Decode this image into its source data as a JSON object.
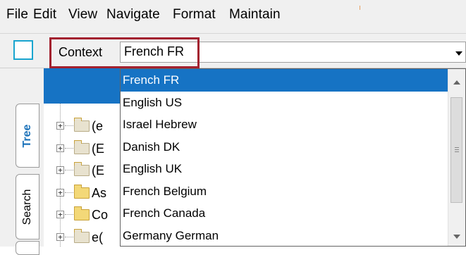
{
  "menu": {
    "items": [
      "File",
      "Edit",
      "View",
      "Navigate",
      "Format",
      "Maintain"
    ]
  },
  "toolbar": {
    "context_label": "Context",
    "context_value": "French FR"
  },
  "sidebar": {
    "tabs": [
      "Tree",
      "Search"
    ]
  },
  "tree": {
    "rows": [
      {
        "text": "(e",
        "folder": "gray"
      },
      {
        "text": "(E",
        "folder": "gray"
      },
      {
        "text": "(E",
        "folder": "gray"
      },
      {
        "text": "As",
        "folder": "yellow"
      },
      {
        "text": "Co",
        "folder": "yellow"
      },
      {
        "text": "e(",
        "folder": "gray"
      }
    ]
  },
  "dropdown": {
    "options": [
      "French FR",
      "English US",
      "Israel Hebrew",
      "Danish DK",
      "English UK",
      "French Belgium",
      "French Canada",
      "Germany German"
    ],
    "selected_index": 0
  },
  "colors": {
    "selection": "#1673c4",
    "highlight_box": "#a3212f",
    "tab_active_text": "#1a71b9",
    "icon_square": "#19a5cf"
  }
}
